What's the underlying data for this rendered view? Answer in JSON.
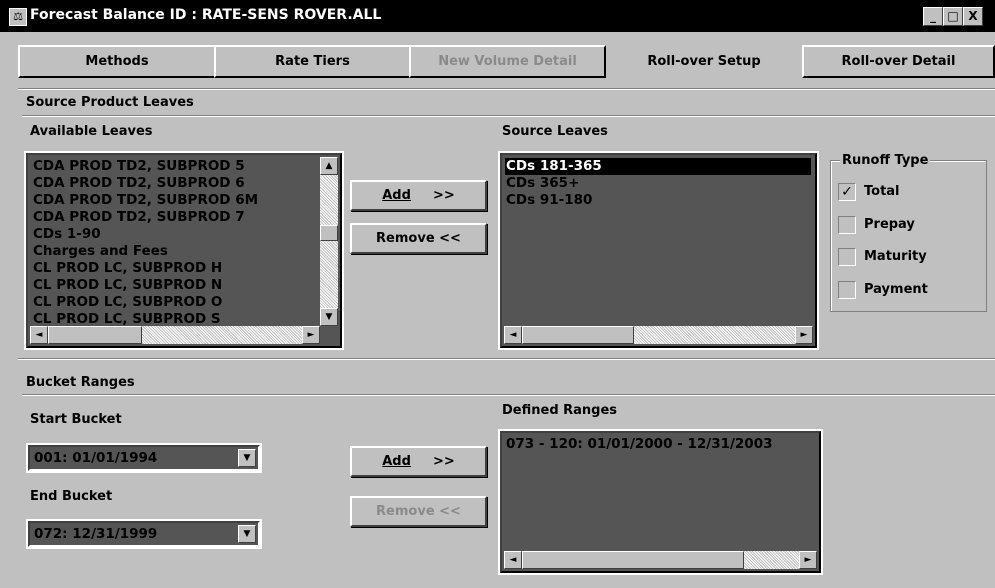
{
  "window": {
    "title": "Forecast Balance ID : RATE-SENS ROVER.ALL",
    "controls": [
      "_",
      "□",
      "X"
    ]
  },
  "tabs": [
    {
      "label": "Methods",
      "state": "normal"
    },
    {
      "label": "Rate Tiers",
      "state": "normal"
    },
    {
      "label": "New Volume Detail",
      "state": "disabled"
    },
    {
      "label": "Roll-over Setup",
      "state": "active"
    },
    {
      "label": "Roll-over Detail",
      "state": "normal"
    }
  ],
  "source_section": {
    "heading": "Source Product Leaves",
    "available_label": "Available Leaves",
    "available_items": [
      "CDA PROD TD2, SUBPROD 5",
      "CDA PROD TD2, SUBPROD 6",
      "CDA PROD TD2, SUBPROD 6M",
      "CDA PROD TD2, SUBPROD 7",
      "CDs 1-90",
      "Charges and Fees",
      "CL PROD LC, SUBPROD H",
      "CL PROD LC, SUBPROD N",
      "CL PROD LC, SUBPROD O",
      "CL PROD LC, SUBPROD S"
    ],
    "add_label": "Add",
    "add_arrows": ">>",
    "remove_label": "Remove <<",
    "source_label": "Source Leaves",
    "source_items": [
      "CDs 181-365",
      "CDs 365+",
      "CDs 91-180"
    ],
    "selected_source": "CDs 181-365"
  },
  "runoff": {
    "title": "Runoff Type",
    "options": [
      {
        "label": "Total",
        "checked": true
      },
      {
        "label": "Prepay",
        "checked": false
      },
      {
        "label": "Maturity",
        "checked": false
      },
      {
        "label": "Payment",
        "checked": false
      }
    ],
    "check_glyph": "✓"
  },
  "bucket_section": {
    "heading": "Bucket Ranges",
    "start_label": "Start Bucket",
    "start_value": "001:  01/01/1994",
    "end_label": "End Bucket",
    "end_value": "072:  12/31/1999",
    "add_label": "Add",
    "add_arrows": ">>",
    "remove_label": "Remove <<",
    "defined_label": "Defined Ranges",
    "defined_items": [
      "073 - 120:   01/01/2000 - 12/31/2003"
    ]
  },
  "glyphs": {
    "up": "▲",
    "down": "▼",
    "left": "◄",
    "right": "►",
    "app": "⚖"
  }
}
